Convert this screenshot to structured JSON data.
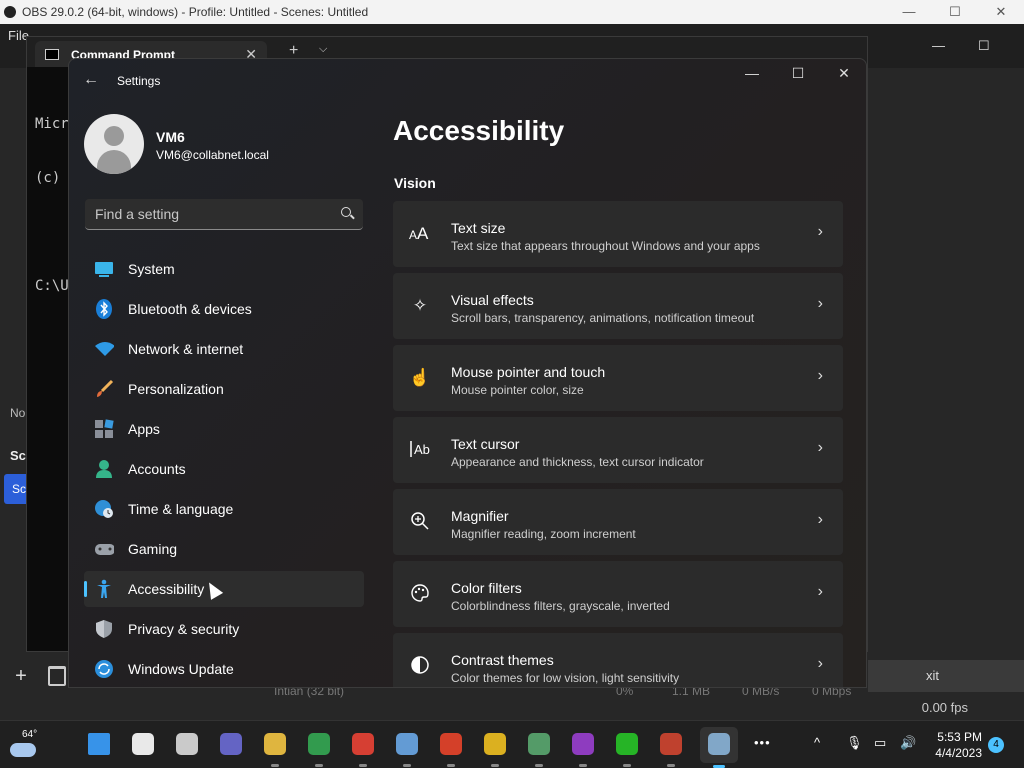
{
  "obs": {
    "title": "OBS 29.0.2 (64-bit, windows) - Profile: Untitled - Scenes: Untitled",
    "minimize_icon": "—",
    "maximize_icon": "☐",
    "close_icon": "✕",
    "menu_file": "File",
    "left_labels": [
      "No",
      "Sc",
      "Sc"
    ],
    "bottom_row": [
      "Intian (32 bit)",
      "0%",
      "1.1 MB",
      "0 MB/s",
      "0 Mbps"
    ],
    "exit_label": "xit",
    "fps_label": "0.00 fps"
  },
  "cmd": {
    "tab_title": "Command Prompt",
    "lines": [
      "Micr",
      "(c)",
      "",
      "C:\\U"
    ]
  },
  "settings": {
    "window_title": "Settings",
    "profile": {
      "name": "VM6",
      "email": "VM6@collabnet.local"
    },
    "search": {
      "placeholder": "Find a setting"
    },
    "nav": [
      {
        "label": "System",
        "icon": "system-icon"
      },
      {
        "label": "Bluetooth & devices",
        "icon": "bluetooth-icon"
      },
      {
        "label": "Network & internet",
        "icon": "wifi-icon"
      },
      {
        "label": "Personalization",
        "icon": "brush-icon"
      },
      {
        "label": "Apps",
        "icon": "apps-icon"
      },
      {
        "label": "Accounts",
        "icon": "accounts-icon"
      },
      {
        "label": "Time & language",
        "icon": "globe-clock-icon"
      },
      {
        "label": "Gaming",
        "icon": "gamepad-icon"
      },
      {
        "label": "Accessibility",
        "icon": "accessibility-icon",
        "active": true
      },
      {
        "label": "Privacy & security",
        "icon": "shield-icon"
      },
      {
        "label": "Windows Update",
        "icon": "update-icon"
      }
    ],
    "page_title": "Accessibility",
    "section": "Vision",
    "cards": [
      {
        "title": "Text size",
        "subtitle": "Text size that appears throughout Windows and your apps",
        "icon": "text-size-icon"
      },
      {
        "title": "Visual effects",
        "subtitle": "Scroll bars, transparency, animations, notification timeout",
        "icon": "sparkle-icon"
      },
      {
        "title": "Mouse pointer and touch",
        "subtitle": "Mouse pointer color, size",
        "icon": "pointer-touch-icon"
      },
      {
        "title": "Text cursor",
        "subtitle": "Appearance and thickness, text cursor indicator",
        "icon": "text-cursor-icon"
      },
      {
        "title": "Magnifier",
        "subtitle": "Magnifier reading, zoom increment",
        "icon": "magnifier-icon"
      },
      {
        "title": "Color filters",
        "subtitle": "Colorblindness filters, grayscale, inverted",
        "icon": "palette-icon"
      },
      {
        "title": "Contrast themes",
        "subtitle": "Color themes for low vision, light sensitivity",
        "icon": "contrast-icon"
      }
    ]
  },
  "taskbar": {
    "weather_temp": "64°",
    "time": "5:53 PM",
    "date": "4/4/2023",
    "notification_count": "4",
    "more_icon": "•••",
    "tray_chevron": "^",
    "apps": [
      {
        "name": "start-button",
        "color": "#3aa0ff"
      },
      {
        "name": "search-button",
        "color": "#ffffff"
      },
      {
        "name": "task-view-button",
        "color": "#dddddd"
      },
      {
        "name": "teams-chat-button",
        "color": "#6b6bd6"
      },
      {
        "name": "file-explorer-button",
        "color": "#f4c542"
      },
      {
        "name": "chrome-button-1",
        "color": "#34a853"
      },
      {
        "name": "chrome-button-2",
        "color": "#ea4335"
      },
      {
        "name": "network-app-button",
        "color": "#6aa9e8"
      },
      {
        "name": "text-app-button",
        "color": "#e8442a"
      },
      {
        "name": "help-app-button",
        "color": "#f0c020"
      },
      {
        "name": "snipping-tool-button",
        "color": "#5aa870"
      },
      {
        "name": "paint-app-button",
        "color": "#9a3fd0"
      },
      {
        "name": "clover-app-button",
        "color": "#27c427"
      },
      {
        "name": "gift-app-button",
        "color": "#d04530"
      },
      {
        "name": "settings-button",
        "color": "#8ab4d8"
      }
    ]
  }
}
